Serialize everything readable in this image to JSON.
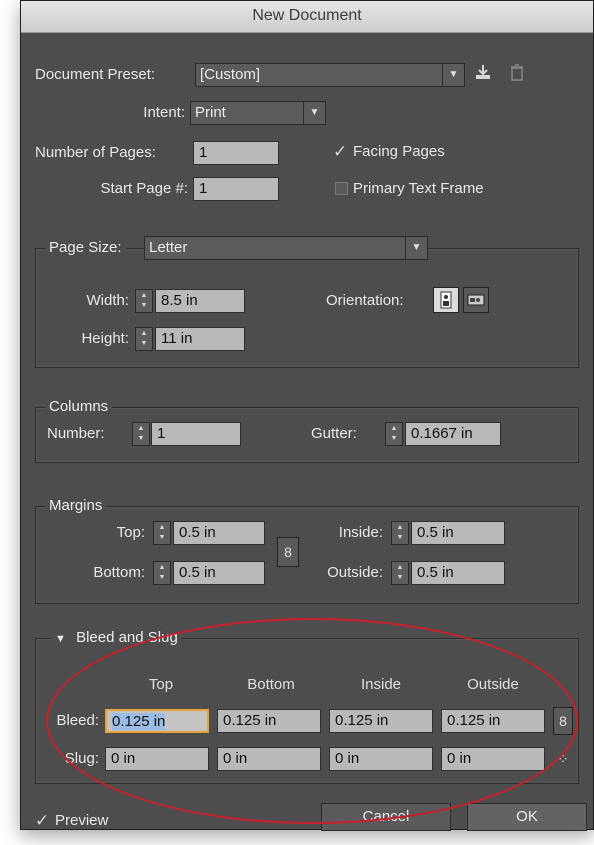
{
  "window": {
    "title": "New Document"
  },
  "document_preset": {
    "label": "Document Preset:",
    "value": "[Custom]",
    "save_icon": "save-preset-icon",
    "delete_icon": "trash-icon"
  },
  "intent": {
    "label": "Intent:",
    "value": "Print"
  },
  "pages": {
    "label": "Number of Pages:",
    "value": "1"
  },
  "start_page": {
    "label": "Start Page #:",
    "value": "1"
  },
  "facing_pages": {
    "label": "Facing Pages",
    "checked": true
  },
  "primary_text_frame": {
    "label": "Primary Text Frame",
    "checked": false
  },
  "page_size": {
    "legend": "Page Size:",
    "value": "Letter",
    "width_label": "Width:",
    "width": "8.5 in",
    "height_label": "Height:",
    "height": "11 in",
    "orientation_label": "Orientation:"
  },
  "columns": {
    "legend": "Columns",
    "number_label": "Number:",
    "number": "1",
    "gutter_label": "Gutter:",
    "gutter": "0.1667 in"
  },
  "margins": {
    "legend": "Margins",
    "top_label": "Top:",
    "top": "0.5 in",
    "bottom_label": "Bottom:",
    "bottom": "0.5 in",
    "inside_label": "Inside:",
    "inside": "0.5 in",
    "outside_label": "Outside:",
    "outside": "0.5 in"
  },
  "bleed_slug": {
    "legend": "Bleed and Slug",
    "columns": [
      "Top",
      "Bottom",
      "Inside",
      "Outside"
    ],
    "bleed_label": "Bleed:",
    "bleed": [
      "0.125 in",
      "0.125 in",
      "0.125 in",
      "0.125 in"
    ],
    "slug_label": "Slug:",
    "slug": [
      "0 in",
      "0 in",
      "0 in",
      "0 in"
    ]
  },
  "preview": {
    "label": "Preview",
    "checked": true
  },
  "buttons": {
    "cancel": "Cancel",
    "ok": "OK"
  },
  "colors": {
    "dialog_bg": "#4d4d4d",
    "field_bg": "#b9b9b9",
    "annotation": "#c8202a",
    "focus": "#e8a23a"
  }
}
